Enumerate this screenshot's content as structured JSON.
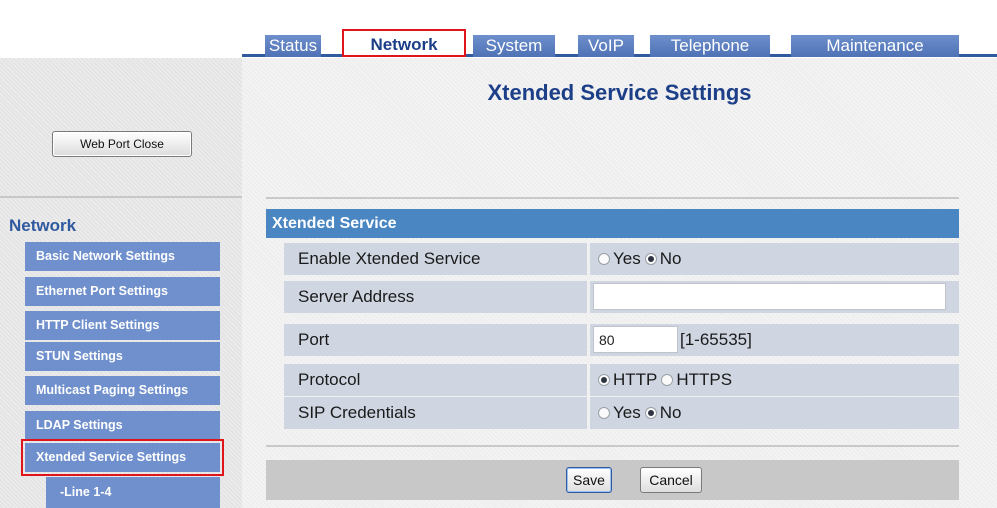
{
  "tabs": [
    {
      "label": "Status",
      "active": false
    },
    {
      "label": "Network",
      "active": true
    },
    {
      "label": "System",
      "active": false
    },
    {
      "label": "VoIP",
      "active": false
    },
    {
      "label": "Telephone",
      "active": false
    },
    {
      "label": "Maintenance",
      "active": false
    }
  ],
  "sidebar": {
    "web_port_button": "Web Port Close",
    "heading": "Network",
    "items": [
      {
        "label": "Basic Network Settings"
      },
      {
        "label": "Ethernet Port Settings"
      },
      {
        "label": "HTTP Client Settings"
      },
      {
        "label": "STUN Settings"
      },
      {
        "label": "Multicast Paging Settings"
      },
      {
        "label": "LDAP Settings"
      },
      {
        "label": "Xtended Service Settings",
        "selected": true
      }
    ],
    "sub_item": "-Line 1-4"
  },
  "main": {
    "title": "Xtended Service Settings",
    "section_title": "Xtended Service",
    "rows": [
      {
        "label": "Enable Xtended Service",
        "options": [
          "Yes",
          "No"
        ],
        "selected": "No"
      },
      {
        "label": "Server Address",
        "value": ""
      },
      {
        "label": "Port",
        "value": "80",
        "hint": "[1-65535]"
      },
      {
        "label": "Protocol",
        "options": [
          "HTTP",
          "HTTPS"
        ],
        "selected": "HTTP"
      },
      {
        "label": "SIP Credentials",
        "options": [
          "Yes",
          "No"
        ],
        "selected": "No"
      }
    ],
    "save_label": "Save",
    "cancel_label": "Cancel"
  },
  "colors": {
    "tab_bg": "#5a7cc0",
    "active_tab_text": "#1c3f88",
    "highlight_border": "#e0141b",
    "nav_item_bg": "#6f90cd",
    "section_header_bg": "#4a86c2",
    "row_bg": "#cfd6e2"
  }
}
